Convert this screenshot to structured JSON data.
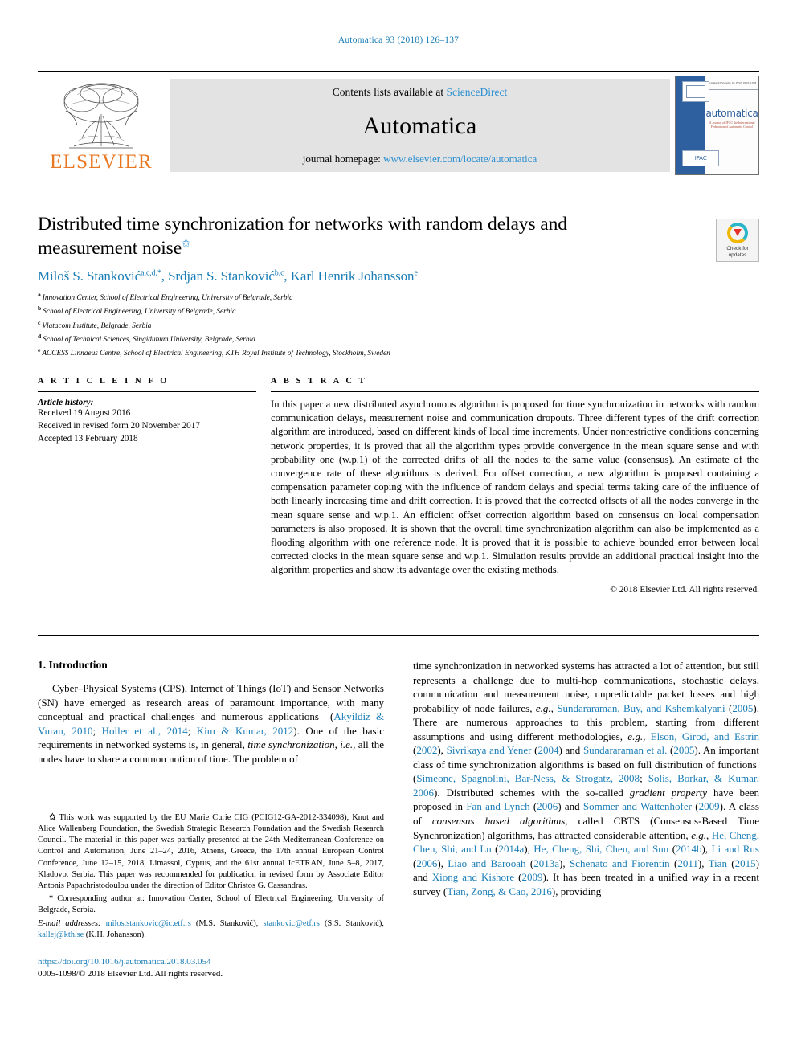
{
  "running_head": "Automatica 93 (2018) 126–137",
  "masthead": {
    "publisher_logo_text": "ELSEVIER",
    "contents_prefix": "Contents lists available at ",
    "contents_link": "ScienceDirect",
    "journal_name": "Automatica",
    "homepage_prefix": "journal homepage: ",
    "homepage_url": "www.elsevier.com/locate/automatica",
    "cover": {
      "title": "automatica",
      "subtitle": "A Journal of IFAC the International Federation of Automatic Control",
      "top_line": "Volume 93    Volume 93    ISSN 0005-1098",
      "badge": "IFAC"
    }
  },
  "title": {
    "text": "Distributed time synchronization for networks with random delays and measurement noise",
    "footnote_marker": "✩"
  },
  "crossmark": {
    "line1": "Check for",
    "line2": "updates",
    "label": "Check for updates"
  },
  "authors": [
    {
      "name": "Miloš S. Stanković",
      "sups": "a,c,d,*"
    },
    {
      "name": "Srdjan S. Stanković",
      "sups": "b,c"
    },
    {
      "name": "Karl Henrik Johansson",
      "sups": "e"
    }
  ],
  "affiliations": [
    {
      "mark": "a",
      "text": "Innovation Center, School of Electrical Engineering, University of Belgrade, Serbia"
    },
    {
      "mark": "b",
      "text": "School of Electrical Engineering, University of Belgrade, Serbia"
    },
    {
      "mark": "c",
      "text": "Vlatacom Institute, Belgrade, Serbia"
    },
    {
      "mark": "d",
      "text": "School of Technical Sciences, Singidunum University, Belgrade, Serbia"
    },
    {
      "mark": "e",
      "text": "ACCESS Linnaeus Centre, School of Electrical Engineering, KTH Royal Institute of Technology, Stockholm, Sweden"
    }
  ],
  "article_info": {
    "heading": "A R T I C L E   I N F O",
    "history_label": "Article history:",
    "history": [
      "Received 19 August 2016",
      "Received in revised form 20 November 2017",
      "Accepted 13 February 2018"
    ]
  },
  "abstract": {
    "heading": "A B S T R A C T",
    "text": "In this paper a new distributed asynchronous algorithm is proposed for time synchronization in networks with random communication delays, measurement noise and communication  dropouts. Three different types of the drift correction algorithm are introduced, based on different kinds of local time increments. Under nonrestrictive conditions concerning network properties, it is proved that all the algorithm types provide convergence in the mean square sense and with probability one  (w.p.1) of the corrected drifts of all the nodes to the same value (consensus). An estimate of the convergence rate of these algorithms is derived. For offset correction, a new algorithm is proposed containing a compensation parameter coping with the influence of random delays and special terms taking care of the influence of both linearly increasing time and drift correction. It is proved that the corrected offsets of all the nodes converge in the mean square sense and w.p.1. An efficient offset correction algorithm based on consensus on local compensation parameters is also proposed. It is shown that the overall time synchronization algorithm can also be implemented as a flooding algorithm with one reference node. It is proved that it is possible to achieve bounded error between local corrected clocks in the mean square sense and w.p.1. Simulation results provide an additional practical insight into the algorithm properties and show its advantage over the existing methods.",
    "copyright": "© 2018 Elsevier Ltd. All rights reserved."
  },
  "introduction": {
    "heading": "1. Introduction",
    "left_paragraph_1": "Cyber–Physical Systems (CPS), Internet of Things (IoT) and Sensor Networks (SN) have emerged as research areas of paramount importance, with many conceptual and practical challenges and numerous applications  (Akyildiz & Vuran, 2010; Holler et al., 2014; Kim & Kumar, 2012). One of the basic requirements in networked systems is, in general, time synchronization, i.e., all the nodes have to share a common notion of time. The problem of",
    "right_paragraph": "time synchronization in networked systems has attracted a lot of attention, but still represents a challenge due to multi-hop communications, stochastic delays, communication and measurement noise, unpredictable packet losses and high probability of node failures, e.g., Sundararaman, Buy, and Kshemkalyani (2005). There are numerous approaches to this problem, starting from different assumptions and using different methodologies, e.g., Elson, Girod, and Estrin (2002), Sivrikaya and Yener (2004) and Sundararaman et al. (2005). An important class of time synchronization algorithms is based on full distribution of functions (Simeone, Spagnolini, Bar-Ness, & Strogatz, 2008; Solis, Borkar, & Kumar, 2006). Distributed schemes with the so-called gradient property have been proposed in Fan and Lynch (2006) and Sommer and Wattenhofer (2009). A class of consensus based algorithms, called CBTS (Consensus-Based Time Synchronization) algorithms, has attracted considerable attention, e.g., He, Cheng, Chen, Shi, and Lu (2014a), He, Cheng, Shi, Chen, and Sun (2014b), Li and Rus (2006), Liao and Barooah (2013a), Schenato and Fiorentin (2011), Tian (2015) and Xiong and Kishore (2009). It has been treated in a unified way in a recent survey (Tian, Zong, & Cao, 2016), providing"
  },
  "footnotes": {
    "star_symbol": "✩",
    "funding": "This work was supported by the EU Marie Curie CIG (PCIG12-GA-2012-334098), Knut and Alice Wallenberg Foundation, the Swedish Strategic Research Foundation and the Swedish Research Council. The material in this paper was partially presented at the 24th Mediterranean Conference on Control and Automation, June 21–24, 2016, Athens, Greece, the 17th annual European Control Conference, June 12–15, 2018, Limassol, Cyprus, and the 61st annual IcETRAN, June 5–8, 2017, Kladovo, Serbia. This paper was recommended for publication in revised form by Associate Editor Antonis Papachristodoulou under the direction of Editor Christos G. Cassandras.",
    "corresponding_symbol": "*",
    "corresponding": "Corresponding author at: Innovation Center, School of Electrical Engineering, University of Belgrade, Serbia.",
    "email_label": "E-mail addresses:",
    "emails": [
      {
        "address": "milos.stankovic@ic.etf.rs",
        "owner": "(M.S. Stanković)"
      },
      {
        "address": "stankovic@etf.rs",
        "owner": "(S.S. Stanković)"
      },
      {
        "address": "kallej@kth.se",
        "owner": "(K.H. Johansson)"
      }
    ]
  },
  "doi_block": {
    "doi": "https://doi.org/10.1016/j.automatica.2018.03.054",
    "issn_line": "0005-1098/© 2018 Elsevier Ltd. All rights reserved."
  },
  "colors": {
    "link_blue": "#1a7db6",
    "elsevier_orange": "#E87722",
    "band_gray": "#e3e3e3"
  }
}
